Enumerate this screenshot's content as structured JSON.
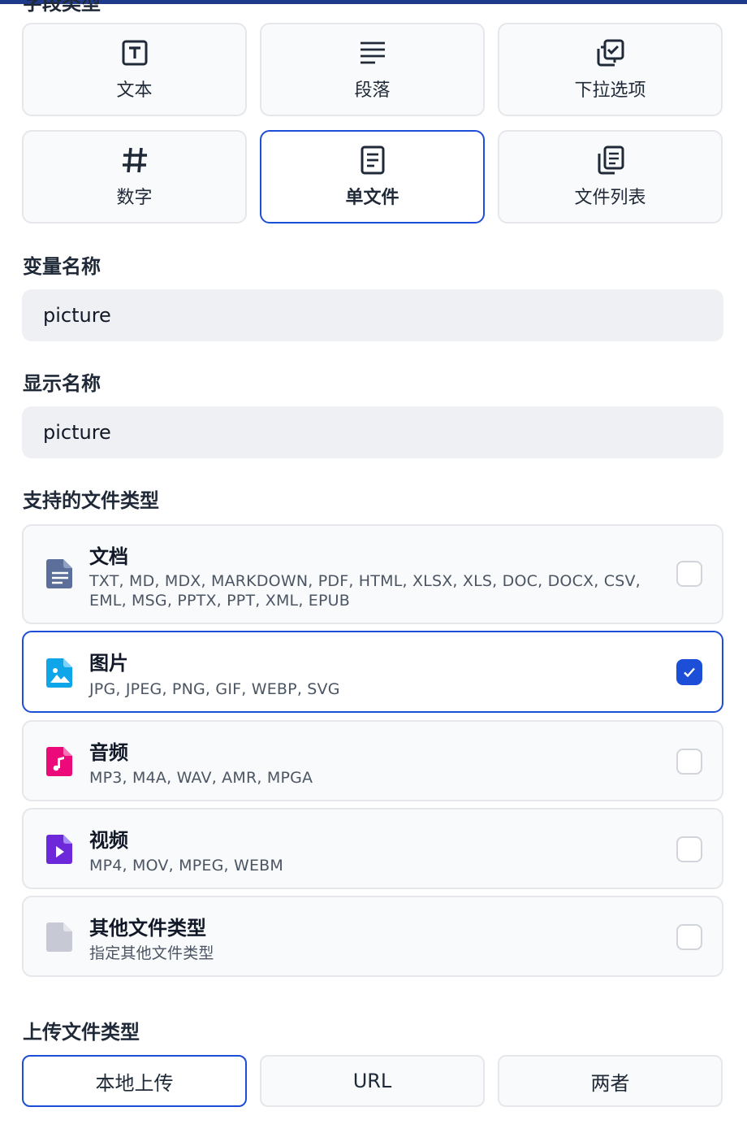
{
  "header": {
    "cut_heading": "字段类型"
  },
  "field_types": [
    {
      "label": "文本",
      "icon": "text-field-icon",
      "selected": false
    },
    {
      "label": "段落",
      "icon": "paragraph-icon",
      "selected": false
    },
    {
      "label": "下拉选项",
      "icon": "select-options-icon",
      "selected": false
    },
    {
      "label": "数字",
      "icon": "hash-icon",
      "selected": false
    },
    {
      "label": "单文件",
      "icon": "file-icon",
      "selected": true
    },
    {
      "label": "文件列表",
      "icon": "file-list-icon",
      "selected": false
    }
  ],
  "variable_name": {
    "label": "变量名称",
    "value": "picture"
  },
  "display_name": {
    "label": "显示名称",
    "value": "picture"
  },
  "supported_types": {
    "label": "支持的文件类型",
    "items": [
      {
        "title": "文档",
        "desc": "TXT, MD, MDX, MARKDOWN, PDF, HTML, XLSX, XLS, DOC, DOCX, CSV, EML, MSG, PPTX, PPT, XML, EPUB",
        "icon": "document-icon",
        "checked": false,
        "color": "#5b6f9a"
      },
      {
        "title": "图片",
        "desc": "JPG, JPEG, PNG, GIF, WEBP, SVG",
        "icon": "image-icon",
        "checked": true,
        "color": "#0ea5e9"
      },
      {
        "title": "音频",
        "desc": "MP3, M4A, WAV, AMR, MPGA",
        "icon": "audio-icon",
        "checked": false,
        "color": "#ec0a7b"
      },
      {
        "title": "视频",
        "desc": "MP4, MOV, MPEG, WEBM",
        "icon": "video-icon",
        "checked": false,
        "color": "#6d28d9"
      },
      {
        "title": "其他文件类型",
        "desc": "指定其他文件类型",
        "icon": "other-file-icon",
        "checked": false,
        "color": "#c7cad4"
      }
    ]
  },
  "upload_method": {
    "label": "上传文件类型",
    "options": [
      {
        "label": "本地上传",
        "selected": true
      },
      {
        "label": "URL",
        "selected": false
      },
      {
        "label": "两者",
        "selected": false
      }
    ]
  },
  "colors": {
    "accent": "#1d4ed8",
    "border": "#e5e7eb",
    "field_bg": "#eef0f3",
    "top_stripe": "#1e3a8a"
  }
}
